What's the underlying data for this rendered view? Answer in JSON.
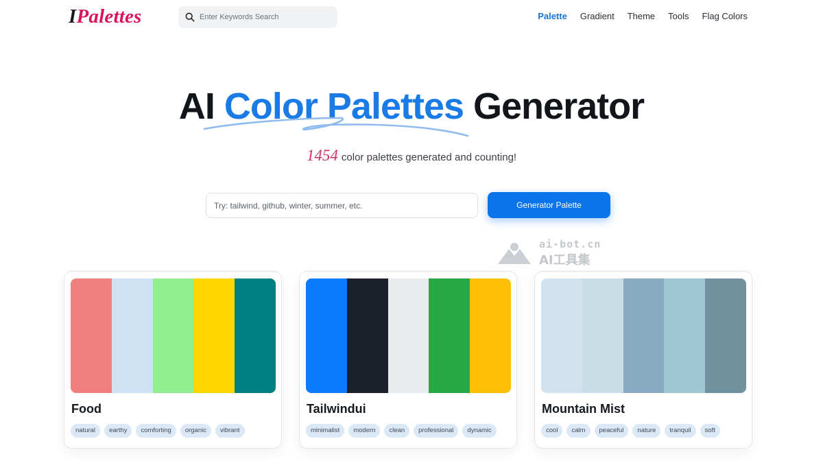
{
  "header": {
    "logo_first": "I",
    "logo_rest": "Palettes",
    "search": {
      "placeholder": "Enter Keywords Search",
      "icon": "search-icon"
    },
    "nav": [
      "Palette",
      "Gradient",
      "Theme",
      "Tools",
      "Flag Colors"
    ],
    "active_nav": "Palette"
  },
  "hero": {
    "title_before": "AI ",
    "title_accent": "Color Palettes",
    "title_after": " Generator",
    "count": "1454",
    "count_text": "color palettes generated and counting!"
  },
  "generator": {
    "placeholder": "Try: tailwind, github, winter, summer, etc.",
    "button_label": "Generator Palette"
  },
  "watermark": {
    "url": "ai-bot.cn",
    "name": "AI工具集"
  },
  "colors": {
    "accent": "#1a7ae6",
    "brand": "#d9145f",
    "button": "#0b74ea"
  },
  "palettes": [
    {
      "title": "Food",
      "colors": [
        "#f08080",
        "#cfe2f3",
        "#90ee90",
        "#ffd700",
        "#008080"
      ],
      "tags": [
        "natural",
        "earthy",
        "comforting",
        "organic",
        "vibrant"
      ]
    },
    {
      "title": "Tailwindui",
      "colors": [
        "#0a7aff",
        "#1b202b",
        "#e7ebee",
        "#28a745",
        "#ffc107"
      ],
      "tags": [
        "minimalist",
        "modern",
        "clean",
        "professional",
        "dynamic"
      ]
    },
    {
      "title": "Mountain Mist",
      "colors": [
        "#d1e2f0",
        "#c9dde6",
        "#8aaac2",
        "#9fc6d3",
        "#71919e"
      ],
      "tags": [
        "cool",
        "calm",
        "peaceful",
        "nature",
        "tranquil",
        "soft"
      ]
    }
  ]
}
